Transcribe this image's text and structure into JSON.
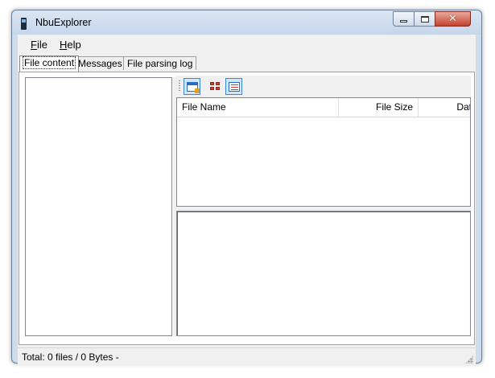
{
  "window": {
    "title": "NbuExplorer"
  },
  "menu": {
    "file": {
      "mnemonic": "F",
      "rest": "ile"
    },
    "help": {
      "mnemonic": "H",
      "rest": "elp"
    }
  },
  "tabs": [
    {
      "label": "File content",
      "active": true
    },
    {
      "label": "Messages",
      "active": false
    },
    {
      "label": "File parsing log",
      "active": false
    }
  ],
  "toolbar": {
    "buttons": [
      {
        "icon": "export-icon",
        "checked": true
      },
      {
        "icon": "large-icons-view-icon",
        "checked": false
      },
      {
        "icon": "details-view-icon",
        "checked": true
      }
    ]
  },
  "file_list": {
    "columns": [
      {
        "label": "File Name"
      },
      {
        "label": "File Size"
      },
      {
        "label": "Dat"
      }
    ],
    "rows": []
  },
  "status": {
    "text": "Total: 0 files / 0 Bytes  -"
  },
  "colors": {
    "accent": "#3a86d6",
    "close_button": "#c6422d",
    "title_bar": "#cfdcec"
  }
}
